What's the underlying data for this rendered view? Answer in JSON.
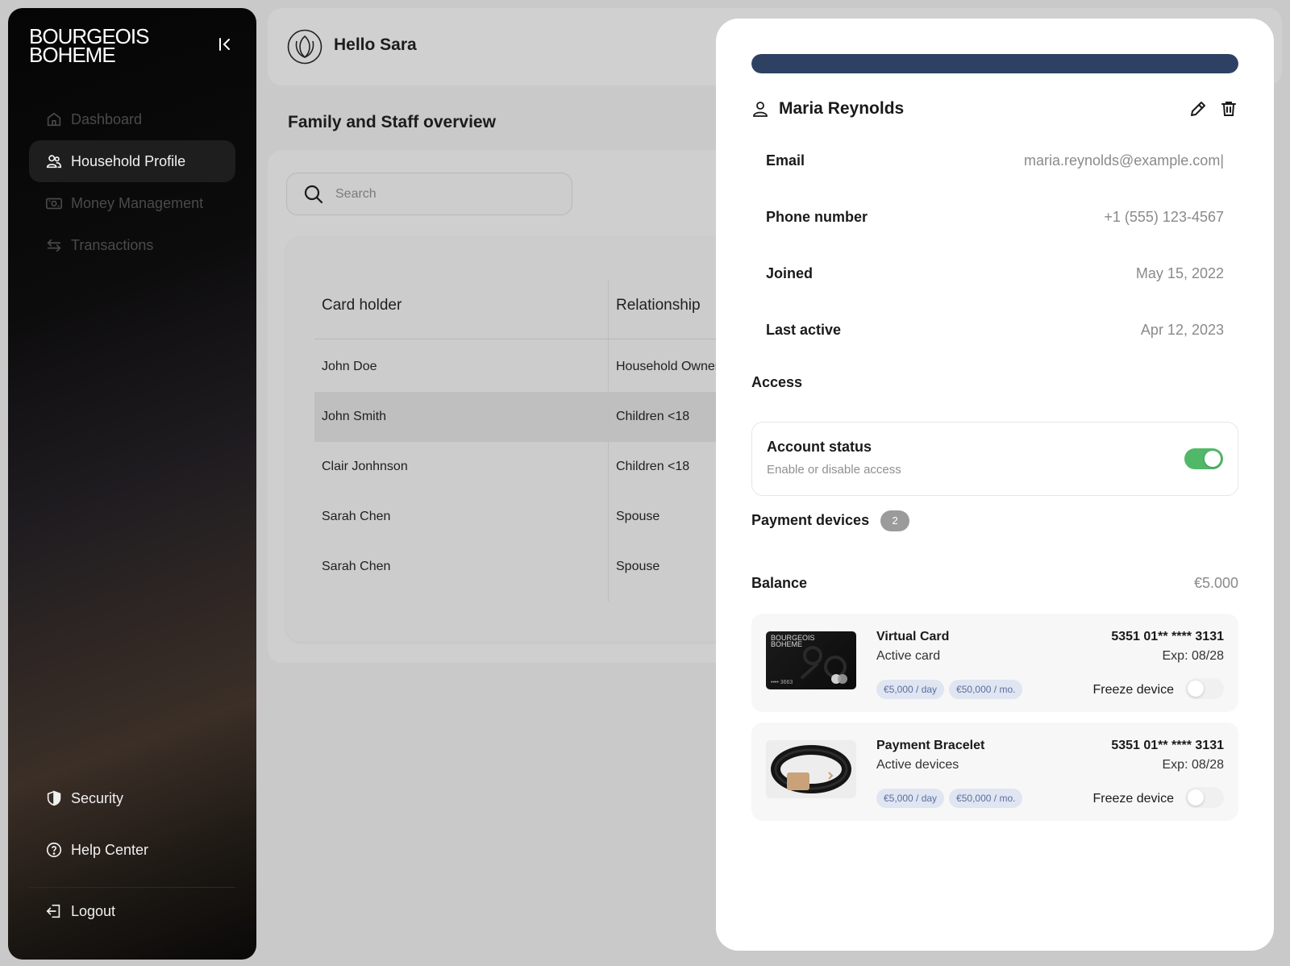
{
  "sidebar": {
    "logo_line1": "BOURGEOIS",
    "logo_line2": "BOHEME",
    "collapse_icon": "collapse-left-icon",
    "nav": [
      {
        "label": "Dashboard",
        "icon": "home-icon",
        "active": false
      },
      {
        "label": "Household Profile",
        "icon": "users-icon",
        "active": true
      },
      {
        "label": "Money Management",
        "icon": "money-icon",
        "active": false
      },
      {
        "label": "Transactions",
        "icon": "swap-icon",
        "active": false
      }
    ],
    "bottom_nav": [
      {
        "label": "Security",
        "icon": "shield-icon"
      },
      {
        "label": "Help Center",
        "icon": "help-icon"
      },
      {
        "label": "Logout",
        "icon": "logout-icon"
      }
    ]
  },
  "header": {
    "greeting": "Hello Sara",
    "brand_icon": "lotus-icon"
  },
  "main": {
    "title": "Family and Staff overview",
    "search_placeholder": "Search",
    "table": {
      "columns": [
        "Card holder",
        "Relationship"
      ],
      "rows": [
        {
          "holder": "John Doe",
          "relationship": "Household Owner"
        },
        {
          "holder": "John Smith",
          "relationship": "Children <18"
        },
        {
          "holder": "Clair Jonhnson",
          "relationship": "Children <18"
        },
        {
          "holder": "Sarah Chen",
          "relationship": "Spouse"
        },
        {
          "holder": "Sarah Chen",
          "relationship": "Spouse"
        }
      ],
      "highlighted_row": 1
    }
  },
  "drawer": {
    "progress_percent": 100,
    "progress_color": "#2f4163",
    "name": "Maria Reynolds",
    "fields": [
      {
        "label": "Email",
        "value": "maria.reynolds@example.com|"
      },
      {
        "label": "Phone number",
        "value": "+1 (555) 123-4567"
      },
      {
        "label": "Joined",
        "value": "May 15, 2022"
      },
      {
        "label": "Last active",
        "value": "Apr 12, 2023"
      }
    ],
    "access": {
      "section_title": "Access",
      "status_title": "Account status",
      "status_sub": "Enable or disable access",
      "enabled": true,
      "toggle_color": "#52b869"
    },
    "payment_devices": {
      "title": "Payment devices",
      "count": "2"
    },
    "balance": {
      "label": "Balance",
      "value": "€5.000"
    },
    "devices": [
      {
        "name": "Virtual Card",
        "status": "Active card",
        "number": "5351 01** **** 3131",
        "exp": "Exp: 08/28",
        "limits": [
          "€5,000 / day",
          "€50,000 / mo."
        ],
        "freeze_label": "Freeze device",
        "frozen": false,
        "thumb_brand_line1": "BOURGEOIS",
        "thumb_brand_line2": "BOHEME",
        "thumb_digits": "•••• 3663"
      },
      {
        "name": "Payment Bracelet",
        "status": "Active devices",
        "number": "5351 01** **** 3131",
        "exp": "Exp: 08/28",
        "limits": [
          "€5,000 / day",
          "€50,000 / mo."
        ],
        "freeze_label": "Freeze device",
        "frozen": false
      }
    ]
  }
}
